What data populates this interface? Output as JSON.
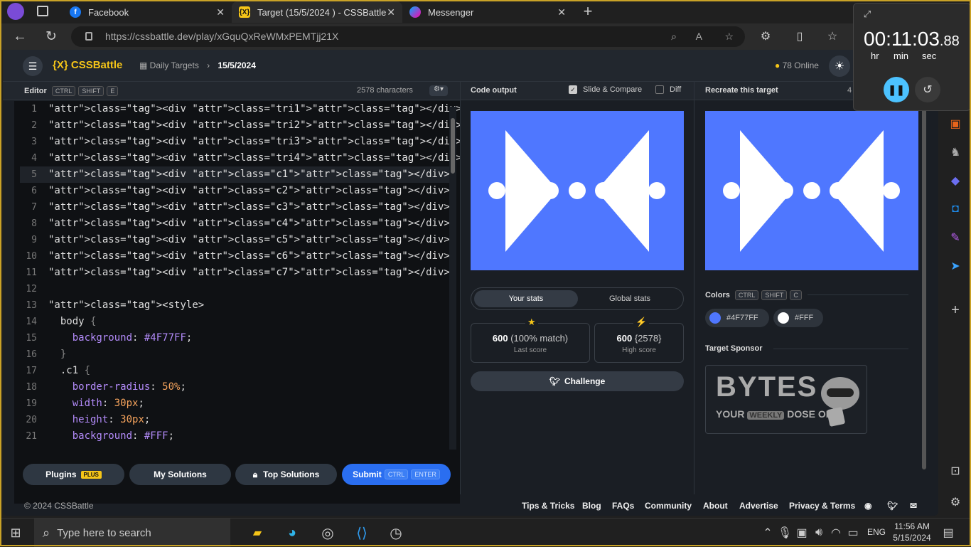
{
  "browser": {
    "tabs": [
      {
        "label": "Facebook",
        "icon": "facebook-icon"
      },
      {
        "label": "Target (15/5/2024 ) - CSSBattle",
        "icon": "cssbattle-icon",
        "active": true
      },
      {
        "label": "Messenger",
        "icon": "messenger-icon"
      }
    ],
    "url": "https://cssbattle.dev/play/xGquQxReWMxPEMTjj21X"
  },
  "nav": {
    "logo": "CSSBattle",
    "logo_mark": "{X}",
    "crumb1": "Daily Targets",
    "crumb2": "15/5/2024",
    "online": "78 Online"
  },
  "editor_header": {
    "label": "Editor",
    "k1": "CTRL",
    "k2": "SHIFT",
    "k3": "E",
    "chars": "2578 characters"
  },
  "output_header": {
    "label": "Code output",
    "slide": "Slide & Compare",
    "diff": "Diff"
  },
  "target_header": {
    "label": "Recreate this target",
    "num": "4"
  },
  "code_lines": [
    {
      "n": "1",
      "t": "<div class=\"tri1\"></div>"
    },
    {
      "n": "2",
      "t": "<div class=\"tri2\"></div>"
    },
    {
      "n": "3",
      "t": "<div class=\"tri3\"></div>"
    },
    {
      "n": "4",
      "t": "<div class=\"tri4\"></div>"
    },
    {
      "n": "5",
      "t": "<div class=\"c1\"></div>"
    },
    {
      "n": "6",
      "t": "<div class=\"c2\"></div>"
    },
    {
      "n": "7",
      "t": "<div class=\"c3\"></div>"
    },
    {
      "n": "8",
      "t": "<div class=\"c4\"></div>"
    },
    {
      "n": "9",
      "t": "<div class=\"c5\"></div>"
    },
    {
      "n": "10",
      "t": "<div class=\"c6\"></div>"
    },
    {
      "n": "11",
      "t": "<div class=\"c7\"></div>"
    },
    {
      "n": "12",
      "t": ""
    },
    {
      "n": "13",
      "t": "<style>"
    },
    {
      "n": "14",
      "t": "  body {"
    },
    {
      "n": "15",
      "t": "    background: #4F77FF;"
    },
    {
      "n": "16",
      "t": "  }"
    },
    {
      "n": "17",
      "t": "  .c1 {"
    },
    {
      "n": "18",
      "t": "    border-radius: 50%;"
    },
    {
      "n": "19",
      "t": "    width: 30px;"
    },
    {
      "n": "20",
      "t": "    height: 30px;"
    },
    {
      "n": "21",
      "t": "    background: #FFF;"
    }
  ],
  "buttons": {
    "plugins": "Plugins",
    "plus": "PLUS",
    "solutions": "My Solutions",
    "top": "Top Solutions",
    "submit": "Submit",
    "sk1": "CTRL",
    "sk2": "ENTER",
    "challenge": "Challenge"
  },
  "stats": {
    "tab1": "Your stats",
    "tab2": "Global stats",
    "last_score": "600",
    "last_match": "(100% match)",
    "last_label": "Last score",
    "high_score": "600",
    "high_chars": "{2578}",
    "high_label": "High score"
  },
  "colors": {
    "label": "Colors",
    "k1": "CTRL",
    "k2": "SHIFT",
    "k3": "C",
    "c1": "#4F77FF",
    "c2": "#FFF"
  },
  "sponsor": {
    "label": "Target Sponsor",
    "line1": "BYTES",
    "line2a": "YOUR",
    "line2b": "WEEKLY",
    "line2c": "DOSE OF"
  },
  "footer": {
    "copyright": "© 2024 CSSBattle",
    "links": [
      "Tips & Tricks",
      "Blog",
      "FAQs",
      "Community",
      "About",
      "Advertise",
      "Privacy & Terms"
    ]
  },
  "timer": {
    "time": "00:11:03",
    "ms": ".88",
    "hr": "hr",
    "min": "min",
    "sec": "sec"
  },
  "taskbar": {
    "search": "Type here to search",
    "lang": "ENG",
    "time": "11:56 AM",
    "date": "5/15/2024"
  }
}
